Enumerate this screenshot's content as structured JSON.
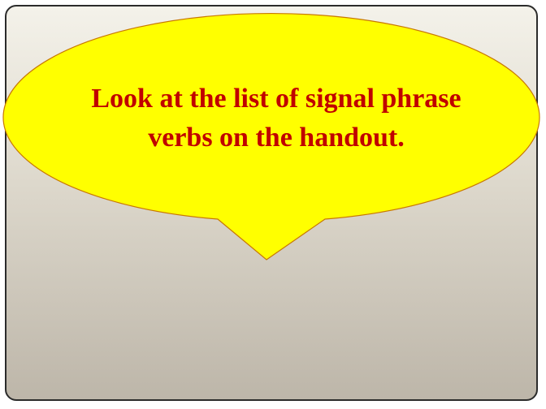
{
  "slide": {
    "callout": {
      "line1": "Look at the list of signal phrase",
      "line2": "verbs on the handout.",
      "fill_color": "#ffff00",
      "border_color": "#c87800",
      "text_color": "#c00000"
    },
    "background_top_color": "#f4f2ea",
    "background_bottom_color": "#bdb6a9"
  }
}
